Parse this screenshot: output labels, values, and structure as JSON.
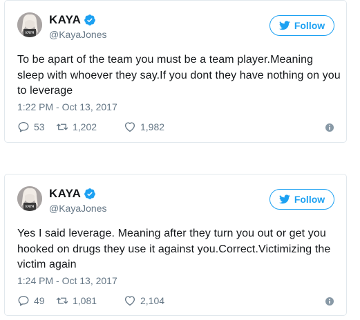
{
  "colors": {
    "accent": "#1da1f2",
    "text": "#14171a",
    "muted": "#657786",
    "border": "#e1e8ed"
  },
  "icons": {
    "verified": "verified-badge-icon",
    "follow": "twitter-bird-icon",
    "reply": "reply-icon",
    "retweet": "retweet-icon",
    "like": "heart-icon",
    "info": "info-icon"
  },
  "tweets": [
    {
      "display_name": "KAYA",
      "avatar_label": "KAYA",
      "handle": "@KayaJones",
      "follow_label": "Follow",
      "text": "To be apart of the team you must be a team player.Meaning sleep with whoever they say.If you dont they have nothing on you to leverage",
      "timestamp": "1:22 PM - Oct 13, 2017",
      "replies": "53",
      "retweets": "1,202",
      "likes": "1,982"
    },
    {
      "display_name": "KAYA",
      "avatar_label": "KAYA",
      "handle": "@KayaJones",
      "follow_label": "Follow",
      "text": "Yes I said leverage. Meaning after they turn you out or get you hooked on drugs they use it against you.Correct.Victimizing the victim again",
      "timestamp": "1:24 PM - Oct 13, 2017",
      "replies": "49",
      "retweets": "1,081",
      "likes": "2,104"
    }
  ]
}
